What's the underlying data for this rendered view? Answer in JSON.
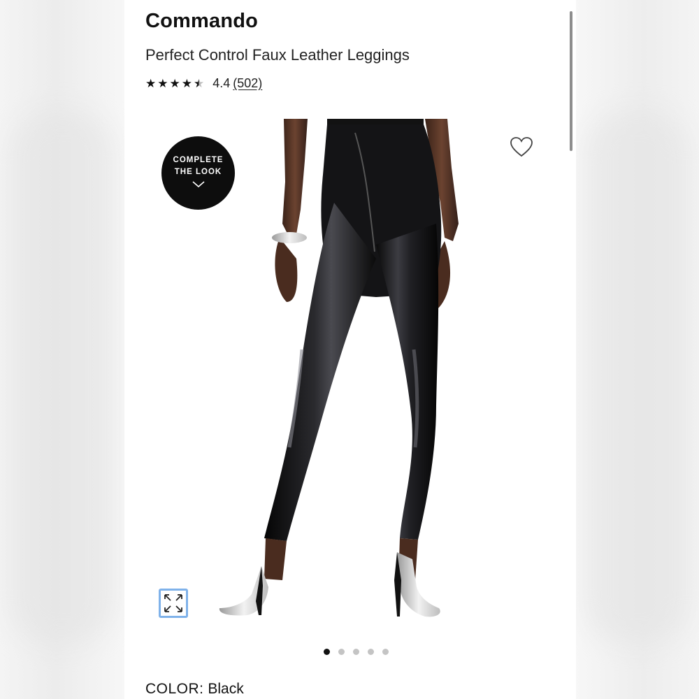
{
  "product": {
    "brand": "Commando",
    "name": "Perfect Control Faux Leather Leggings",
    "rating": {
      "stars": 4.4,
      "value": "4.4",
      "count_text": "(502)"
    }
  },
  "image": {
    "badge_line1": "COMPLETE",
    "badge_line2": "THE LOOK",
    "slide_count": 5,
    "active_slide": 1
  },
  "icons": {
    "badge": "chevron-down-icon",
    "favorite": "heart-icon",
    "zoom": "expand-icon"
  },
  "color": {
    "label": "COLOR:",
    "value": "Black"
  },
  "colors": {
    "accent_focus": "#7fb2ea",
    "badge_bg": "#0d0d0d"
  }
}
